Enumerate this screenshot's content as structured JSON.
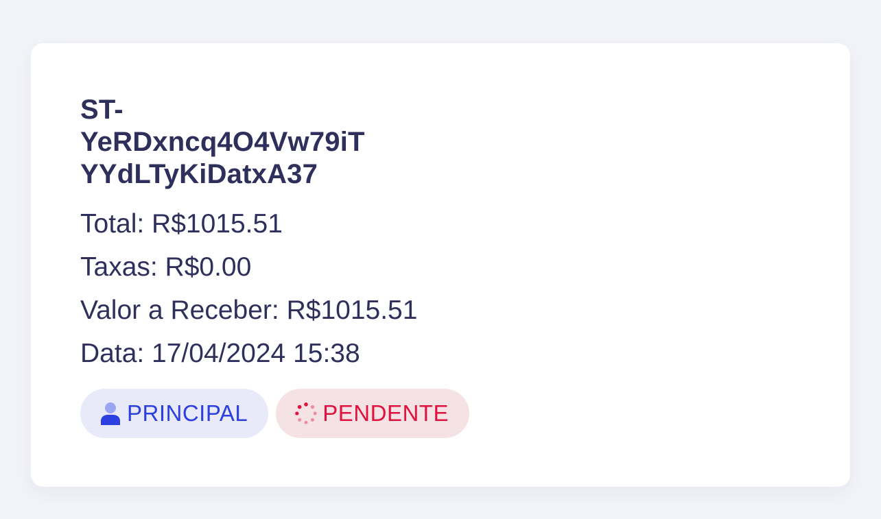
{
  "card": {
    "title_lines": [
      "ST-",
      "YeRDxncq4O4Vw79iT",
      "YYdLTyKiDatxA37"
    ],
    "total": "Total: R$1015.51",
    "taxas": "Taxas: R$0.00",
    "valor_receber": "Valor a Receber: R$1015.51",
    "data": "Data: 17/04/2024 15:38"
  },
  "badges": {
    "account": {
      "label": "PRINCIPAL",
      "icon": "user-icon",
      "color": "#2c3fe0",
      "bg": "#e8eafa"
    },
    "status": {
      "label": "PENDENTE",
      "icon": "spinner-icon",
      "color": "#e0123e",
      "bg": "#f4e2e4"
    }
  }
}
